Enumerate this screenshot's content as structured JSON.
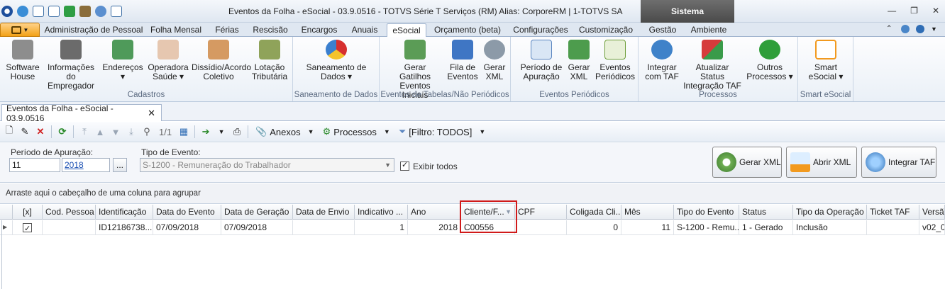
{
  "window": {
    "title": "Eventos da Folha - eSocial - 03.9.0516 - TOTVS Série T Serviços (RM) Alias: CorporeRM | 1-TOTVS SA",
    "context_tab": "Sistema"
  },
  "ribbon_tabs": [
    "Administração de Pessoal",
    "Folha Mensal",
    "Férias",
    "Rescisão",
    "Encargos",
    "Anuais",
    "eSocial",
    "Orçamento (beta)",
    "Configurações",
    "Customização",
    "Gestão",
    "Ambiente"
  ],
  "active_tab": "eSocial",
  "groups": {
    "cadastros": {
      "label": "Cadastros",
      "buttons": [
        "Software House",
        "Informações do Empregador",
        "Endereços",
        "Operadora Saúde",
        "Dissídio/Acordo Coletivo",
        "Lotação Tributária"
      ]
    },
    "saneamento": {
      "label": "Saneamento de Dados",
      "buttons": [
        "Saneamento de Dados"
      ]
    },
    "eventos_tabelas": {
      "label": "Eventos de Tabelas/Não Periódicos",
      "buttons": [
        "Gerar Gatilhos Eventos Iniciais",
        "Fila de Eventos",
        "Gerar XML"
      ]
    },
    "eventos_periodicos": {
      "label": "Eventos Periódicos",
      "buttons": [
        "Período de Apuração",
        "Gerar XML",
        "Eventos Periódicos"
      ]
    },
    "processos": {
      "label": "Processos",
      "buttons": [
        "Integrar com TAF",
        "Atualizar Status Integração TAF",
        "Outros Processos"
      ]
    },
    "smart": {
      "label": "Smart eSocial",
      "buttons": [
        "Smart eSocial"
      ]
    }
  },
  "doc_tab": "Eventos da Folha - eSocial - 03.9.0516",
  "toolbar": {
    "record_count": "1/1",
    "anexos": "Anexos",
    "processos": "Processos",
    "filtro": "[Filtro: TODOS]"
  },
  "filter": {
    "periodo_label": "Período de Apuração:",
    "periodo_mes": "11",
    "periodo_ano": "2018",
    "browse": "...",
    "tipo_label": "Tipo de Evento:",
    "tipo_value": "S-1200 - Remuneração do Trabalhador",
    "exibir_todos": "Exibir todos"
  },
  "action_buttons": {
    "gerar_xml": "Gerar XML",
    "abrir_xml": "Abrir XML",
    "integrar_taf": "Integrar TAF"
  },
  "group_hint": "Arraste aqui o cabeçalho de uma coluna para agrupar",
  "grid": {
    "columns": [
      "[x]",
      "Cod. Pessoa",
      "Identificação",
      "Data do Evento",
      "Data de Geração",
      "Data de Envio",
      "Indicativo ...",
      "Ano",
      "Cliente/F...",
      "CPF",
      "Coligada Cli...",
      "Mês",
      "Tipo do Evento",
      "Status",
      "Tipo da Operação",
      "Ticket TAF",
      "Versão"
    ],
    "rows": [
      [
        "",
        "",
        "ID12186738...",
        "07/09/2018",
        "07/09/2018",
        "",
        "1",
        "2018",
        "C00556",
        "",
        "0",
        "11",
        "S-1200 - Remu...",
        "1 - Gerado",
        "Inclusão",
        "",
        "v02_0"
      ]
    ]
  }
}
